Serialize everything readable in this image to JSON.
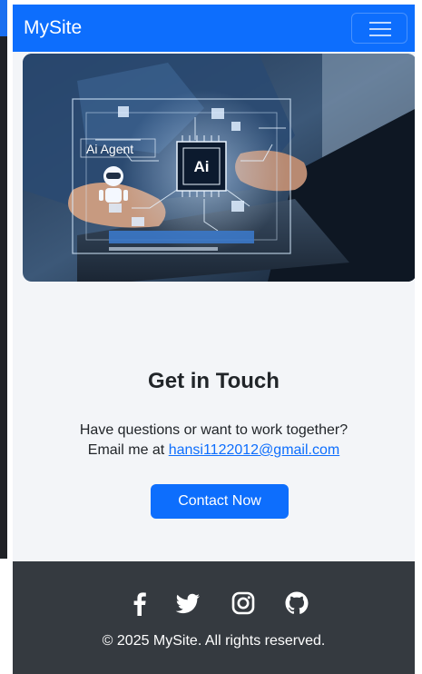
{
  "navbar": {
    "brand": "MySite",
    "toggler_icon": "hamburger-menu-icon",
    "color": "#0d6efd"
  },
  "hero": {
    "image": "laptop-ai-agent-illustration",
    "overlay_text_1": "Ai Agent",
    "overlay_text_2": "Ai"
  },
  "contact": {
    "title": "Get in Touch",
    "line1": "Have questions or want to work together?",
    "line2_prefix": "Email me at",
    "email": "hansi1122012@gmail.com",
    "button_label": "Contact Now"
  },
  "footer": {
    "social_icons": [
      "facebook-icon",
      "twitter-icon",
      "instagram-icon",
      "github-icon"
    ],
    "copyright": "© 2025 MySite. All rights reserved.",
    "background": "#353a40"
  }
}
